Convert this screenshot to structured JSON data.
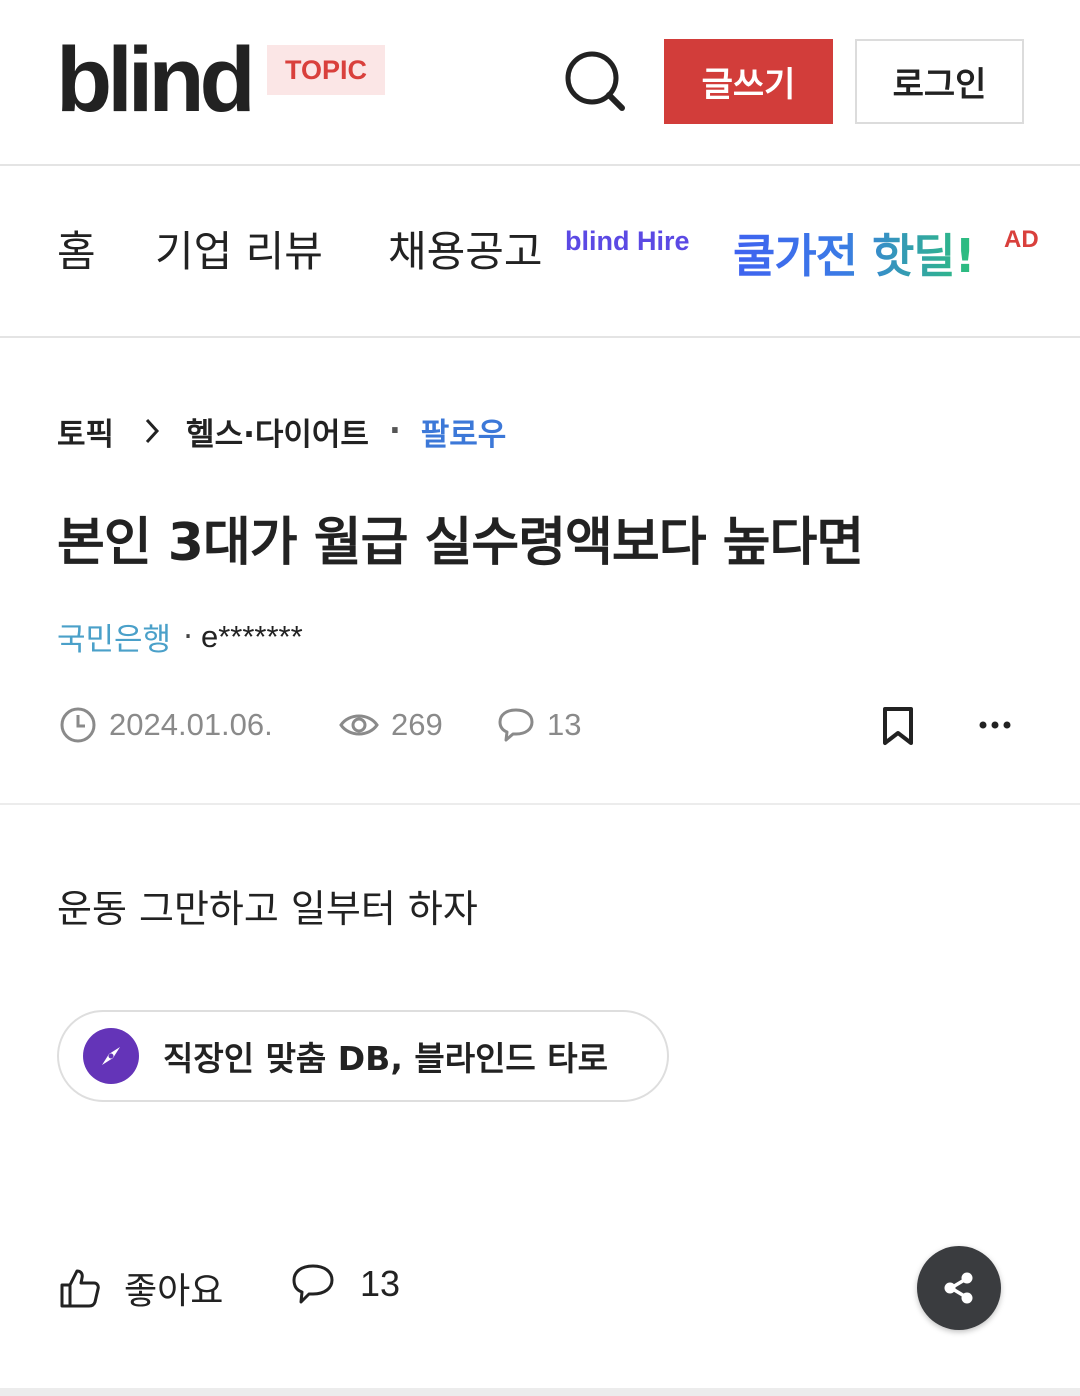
{
  "header": {
    "logo": "blind",
    "badge": "TOPIC",
    "write_label": "글쓰기",
    "login_label": "로그인"
  },
  "nav": {
    "home": "홈",
    "review": "기업 리뷰",
    "jobs": "채용공고",
    "hire_tag": "blind Hire",
    "ad_text": "쿨가전 핫딜!",
    "ad_badge": "AD"
  },
  "breadcrumb": {
    "root": "토픽",
    "category": "헬스·다이어트",
    "follow": "팔로우"
  },
  "post": {
    "title": "본인 3대가 월급 실수령액보다 높다면",
    "company": "국민은행",
    "separator": "·",
    "author": "e*******",
    "date": "2024.01.06.",
    "views": "269",
    "comments": "13",
    "body": "운동 그만하고 일부터 하자"
  },
  "promo": {
    "text": "직장인 맞춤 DB, 블라인드 타로"
  },
  "actions": {
    "like_label": "좋아요",
    "comment_count": "13"
  },
  "colors": {
    "brand_red": "#d23d3a",
    "link_blue": "#3c78d8",
    "company_teal": "#4aa0c9",
    "promo_purple": "#6434b8"
  }
}
